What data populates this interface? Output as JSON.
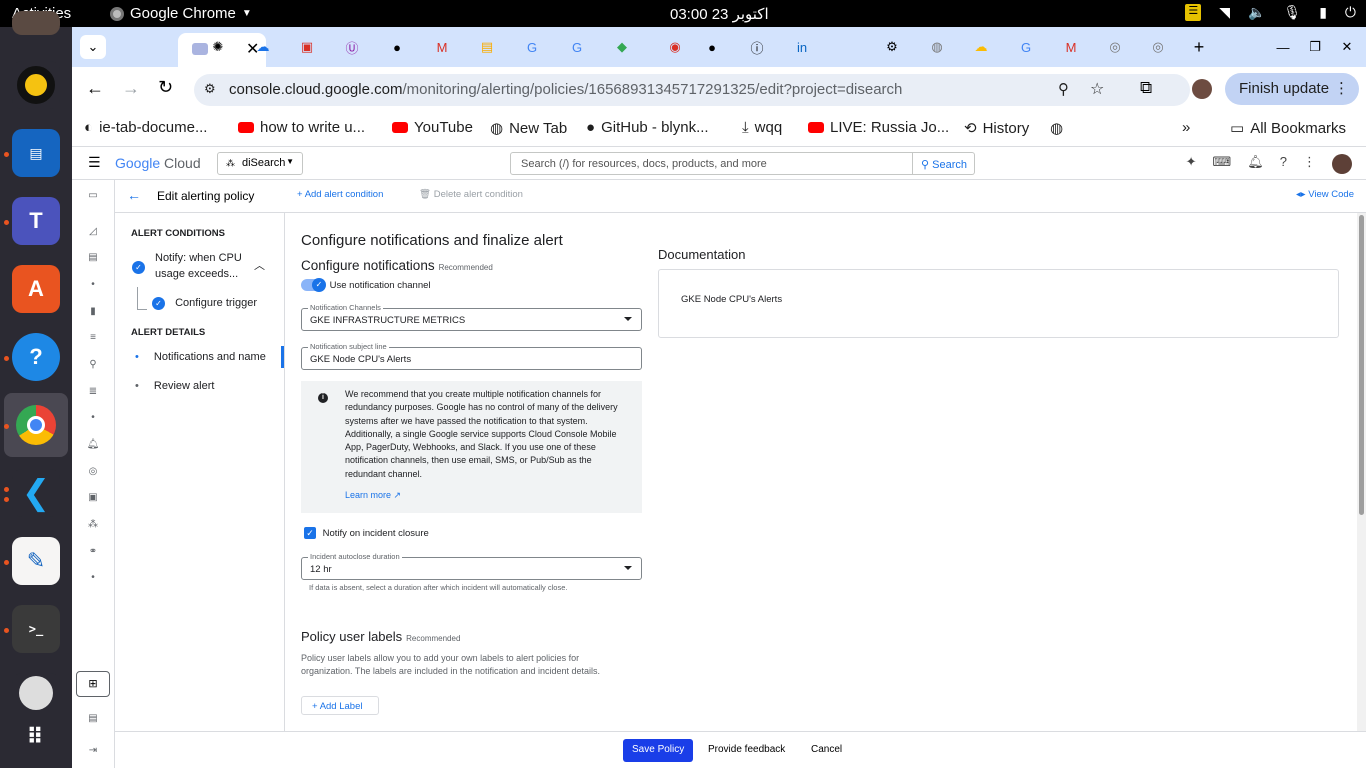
{
  "os": {
    "activities": "Activities",
    "app_name": "Google Chrome",
    "clock": "اكتوبر 23  03:00"
  },
  "browser": {
    "url_host": "console.cloud.google.com",
    "url_path": "/monitoring/alerting/policies/16568931345717291325/edit?project=disearch",
    "finish_update": "Finish update",
    "bookmarks": [
      {
        "label": "ie-tab-docume..."
      },
      {
        "label": "how to write u..."
      },
      {
        "label": "YouTube"
      },
      {
        "label": "New Tab"
      },
      {
        "label": "GitHub - blynk..."
      },
      {
        "label": "wqq"
      },
      {
        "label": "LIVE: Russia Jo..."
      },
      {
        "label": "History"
      }
    ],
    "more_bookmarks": "»",
    "all_bookmarks": "All Bookmarks"
  },
  "console": {
    "logo_google": "Google",
    "logo_cloud": "Cloud",
    "project": "diSearch",
    "search_placeholder": "Search (/) for resources, docs, products, and more",
    "search_button": "Search"
  },
  "toolbar": {
    "title": "Edit alerting policy",
    "add_condition": "Add alert condition",
    "delete_condition": "Delete alert condition",
    "view_code": "View Code"
  },
  "steps": {
    "alert_conditions_heading": "ALERT CONDITIONS",
    "condition_line1": "Notify: when CPU",
    "condition_line2": "usage exceeds...",
    "configure_trigger": "Configure trigger",
    "alert_details_heading": "ALERT DETAILS",
    "notifications_and_name": "Notifications and name",
    "review_alert": "Review alert"
  },
  "main": {
    "title": "Configure notifications and finalize alert",
    "notif_heading": "Configure notifications",
    "recommended": "Recommended",
    "use_channel": "Use notification channel",
    "channels_label": "Notification Channels",
    "channels_value": "GKE INFRASTRUCTURE METRICS",
    "subject_label": "Notification subject line",
    "subject_value": "GKE Node CPU's Alerts",
    "info_text": "We recommend that you create multiple notification channels for redundancy purposes. Google has no control of many of the delivery systems after we have passed the notification to that system. Additionally, a single Google service supports Cloud Console Mobile App, PagerDuty, Webhooks, and Slack. If you use one of these notification channels, then use email, SMS, or Pub/Sub as the redundant channel.",
    "learn_more": "Learn more",
    "notify_closure": "Notify on incident closure",
    "autoclose_label": "Incident autoclose duration",
    "autoclose_value": "12 hr",
    "autoclose_hint": "If data is absent, select a duration after which incident will automatically close.",
    "labels_heading": "Policy user labels",
    "labels_recommended": "Recommended",
    "labels_desc": "Policy user labels allow you to add your own labels to alert policies for organization. The labels are included in the notification and incident details.",
    "add_label": "Add Label",
    "doc_heading": "Documentation",
    "doc_text": "GKE Node CPU's Alerts"
  },
  "footer": {
    "save": "Save Policy",
    "feedback": "Provide feedback",
    "cancel": "Cancel"
  },
  "colors": {
    "accent": "#1a73e8",
    "tabstrip": "#d3e3fd",
    "save_button": "#1a3ee8"
  }
}
